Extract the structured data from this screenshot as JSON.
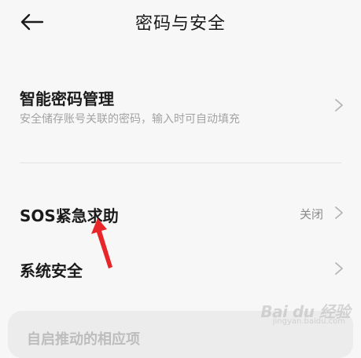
{
  "header": {
    "title": "密码与安全",
    "back_icon": "arrow-left-icon"
  },
  "rows": {
    "password_manager": {
      "title": "智能密码管理",
      "subtitle": "安全储存账号关联的密码，输入时可自动填充",
      "icon": "chevron-right-icon"
    },
    "sos": {
      "title": "SOS紧急求助",
      "value": "关闭",
      "icon": "chevron-right-icon"
    },
    "system_security": {
      "title": "系统安全",
      "icon": "chevron-right-icon"
    }
  },
  "bottom_card": {
    "text": "自启推动的相应项"
  },
  "annotation": {
    "color": "#e8262a"
  },
  "watermark": {
    "text": "Bai du 经验",
    "sub": "jingyan.baidu.com"
  },
  "colors": {
    "background": "#f7f7f7",
    "title_text": "#1b1b1b",
    "secondary_text": "#a3a3a3",
    "chevron": "#b5b5b5"
  }
}
